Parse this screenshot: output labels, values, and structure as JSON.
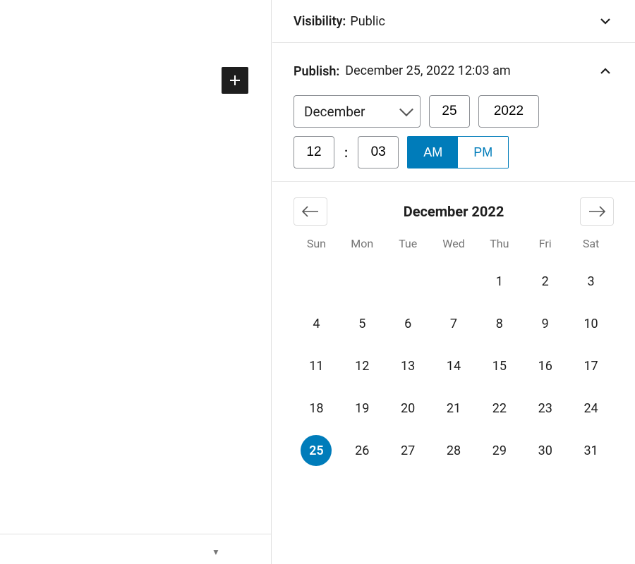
{
  "visibility": {
    "label": "Visibility:",
    "value": "Public"
  },
  "publish": {
    "label": "Publish:",
    "datetime_display": "December 25, 2022 12:03 am",
    "month": "December",
    "day": "25",
    "year": "2022",
    "hour": "12",
    "minute": "03",
    "am_label": "AM",
    "pm_label": "PM",
    "meridiem": "AM"
  },
  "calendar": {
    "title": "December 2022",
    "weekdays": [
      "Sun",
      "Mon",
      "Tue",
      "Wed",
      "Thu",
      "Fri",
      "Sat"
    ],
    "leading_blanks": 4,
    "days_in_month": 31,
    "selected_day": 25
  }
}
